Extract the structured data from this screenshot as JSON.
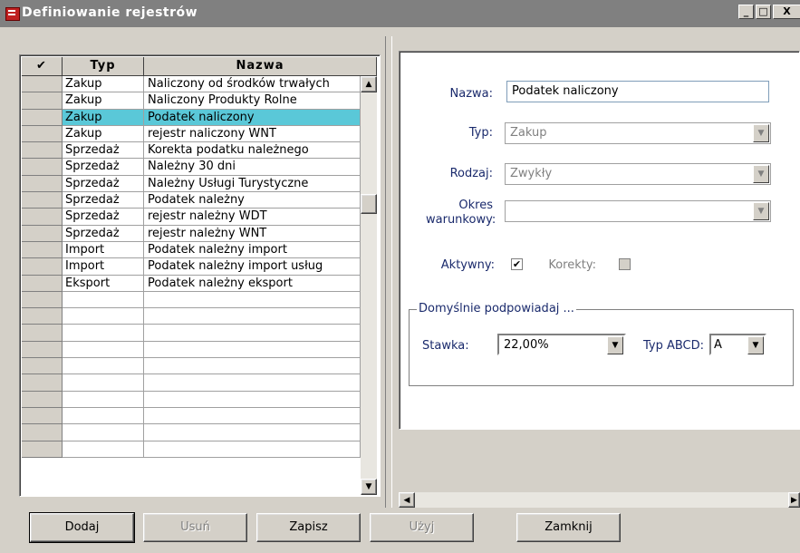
{
  "window": {
    "title": "Definiowanie rejestrów",
    "minimize": "_",
    "maximize": "□",
    "close": "X"
  },
  "grid": {
    "headers": [
      "✔",
      "Typ",
      "Nazwa"
    ],
    "rows": [
      {
        "typ": "Zakup",
        "nazwa": "Naliczony od środków trwałych"
      },
      {
        "typ": "Zakup",
        "nazwa": "Naliczony Produkty Rolne"
      },
      {
        "typ": "Zakup",
        "nazwa": "Podatek naliczony",
        "selected": true
      },
      {
        "typ": "Zakup",
        "nazwa": "rejestr naliczony WNT"
      },
      {
        "typ": "Sprzedaż",
        "nazwa": "Korekta podatku należnego"
      },
      {
        "typ": "Sprzedaż",
        "nazwa": "Należny 30 dni"
      },
      {
        "typ": "Sprzedaż",
        "nazwa": "Należny Usługi Turystyczne"
      },
      {
        "typ": "Sprzedaż",
        "nazwa": "Podatek należny"
      },
      {
        "typ": "Sprzedaż",
        "nazwa": "rejestr należny WDT"
      },
      {
        "typ": "Sprzedaż",
        "nazwa": "rejestr należny WNT"
      },
      {
        "typ": "Import",
        "nazwa": "Podatek należny import"
      },
      {
        "typ": "Import",
        "nazwa": "Podatek należny import usług"
      },
      {
        "typ": "Eksport",
        "nazwa": "Podatek należny eksport"
      },
      {
        "typ": "",
        "nazwa": ""
      },
      {
        "typ": "",
        "nazwa": ""
      },
      {
        "typ": "",
        "nazwa": ""
      },
      {
        "typ": "",
        "nazwa": ""
      },
      {
        "typ": "",
        "nazwa": ""
      },
      {
        "typ": "",
        "nazwa": ""
      },
      {
        "typ": "",
        "nazwa": ""
      },
      {
        "typ": "",
        "nazwa": ""
      },
      {
        "typ": "",
        "nazwa": ""
      },
      {
        "typ": "",
        "nazwa": ""
      }
    ]
  },
  "form": {
    "nazwa_label": "Nazwa:",
    "nazwa_value": "Podatek naliczony",
    "typ_label": "Typ:",
    "typ_value": "Zakup",
    "rodzaj_label": "Rodzaj:",
    "rodzaj_value": "Zwykły",
    "okres_label_1": "Okres",
    "okres_label_2": "warunkowy:",
    "okres_value": "",
    "aktywny_label": "Aktywny:",
    "aktywny_checked": true,
    "korekty_label": "Korekty:",
    "korekty_checked": false,
    "group_title": "Domyślnie podpowiadaj ...",
    "stawka_label": "Stawka:",
    "stawka_value": "22,00%",
    "typabcd_label": "Typ ABCD:",
    "typabcd_value": "A"
  },
  "buttons": {
    "dodaj": "Dodaj",
    "usun": "Usuń",
    "zapisz": "Zapisz",
    "uzyj": "Użyj",
    "zamknij": "Zamknij"
  },
  "colors": {
    "selection": "#5ac8d8",
    "label_text": "#1a2a6c"
  }
}
